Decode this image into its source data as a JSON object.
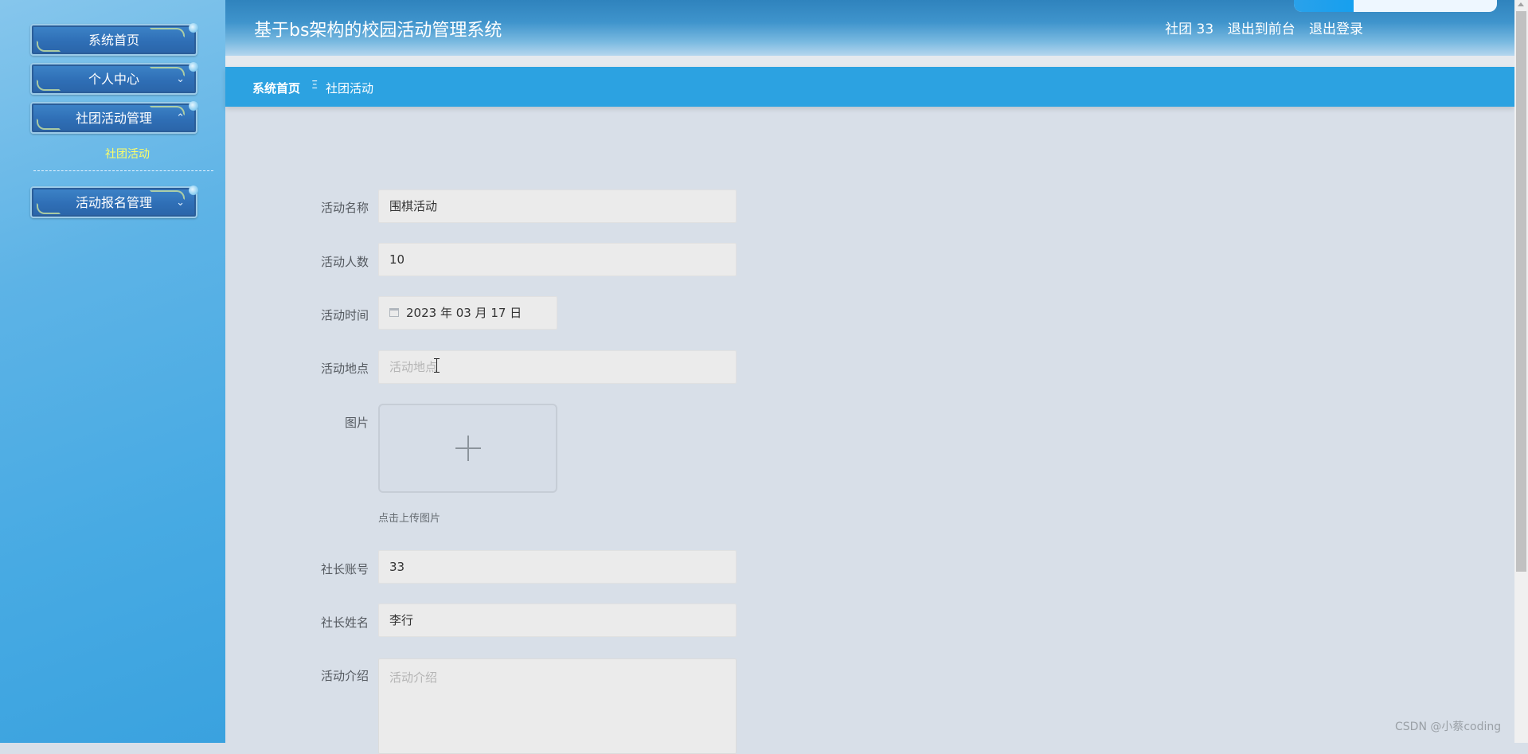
{
  "header": {
    "title": "基于bs架构的校园活动管理系统",
    "user_label": "社团 33",
    "exit_front": "退出到前台",
    "logout": "退出登录"
  },
  "sidebar": {
    "items": [
      {
        "label": "系统首页"
      },
      {
        "label": "个人中心"
      },
      {
        "label": "社团活动管理"
      },
      {
        "label": "活动报名管理"
      }
    ],
    "active_sub_item": "社团活动"
  },
  "breadcrumb": {
    "home": "系统首页",
    "separator": "Ξ",
    "current": "社团活动"
  },
  "form": {
    "activity_name": {
      "label": "活动名称",
      "value": "围棋活动"
    },
    "activity_count": {
      "label": "活动人数",
      "value": "10"
    },
    "activity_time": {
      "label": "活动时间",
      "value": "2023 年 03 月 17 日"
    },
    "activity_location": {
      "label": "活动地点",
      "placeholder": "活动地点"
    },
    "image": {
      "label": "图片",
      "hint": "点击上传图片"
    },
    "leader_account": {
      "label": "社长账号",
      "value": "33"
    },
    "leader_name": {
      "label": "社长姓名",
      "value": "李行"
    },
    "activity_intro": {
      "label": "活动介绍",
      "placeholder": "活动介绍"
    }
  },
  "watermark": "CSDN @小蔡coding",
  "colors": {
    "breadcrumb_bg": "#2ca2e1",
    "sidebar_bg": "#47aae3",
    "active_sub_item": "#ffff66",
    "menu_button": "#2f6fb6"
  }
}
